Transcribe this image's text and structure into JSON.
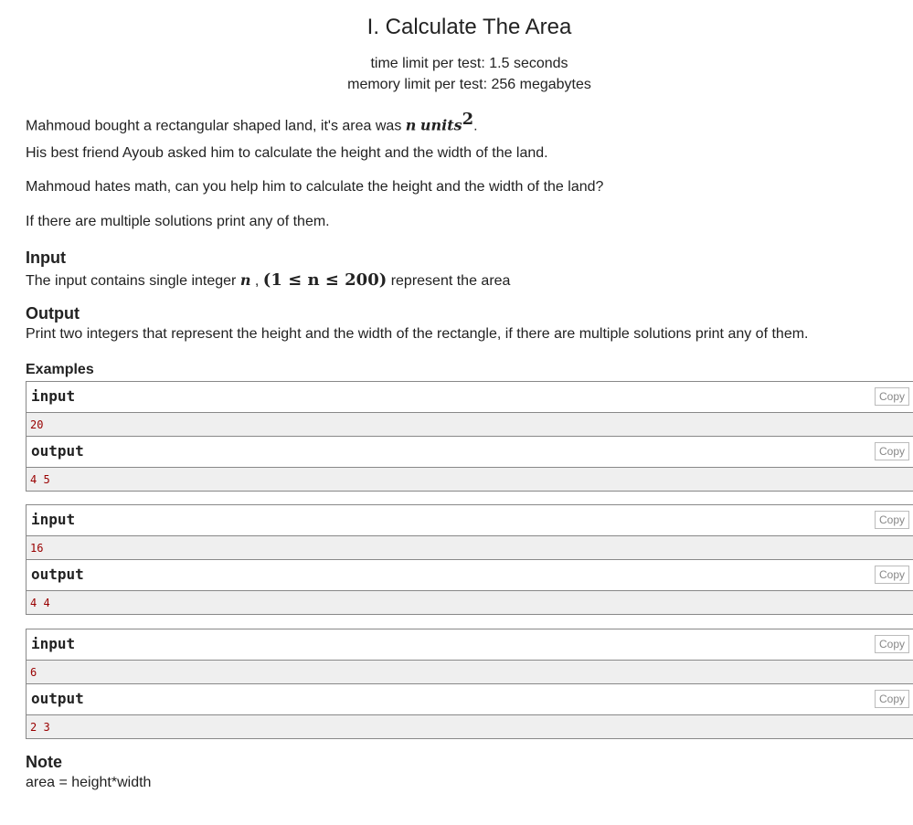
{
  "problem": {
    "title": "I. Calculate The Area",
    "time_limit": "time limit per test: 1.5 seconds",
    "memory_limit": "memory limit per test: 256 megabytes"
  },
  "statement": {
    "p1_text": "Mahmoud bought a rectangular shaped land, it's area was ",
    "p1_math_n": "n",
    "p1_math_units": "units",
    "p1_sup": "2",
    "p1_end": ".",
    "p2": "His best friend Ayoub asked him to calculate the height and the width of the land.",
    "p3": "Mahmoud hates math, can you help him to calculate the height and the width of the land?",
    "p4": "If there are multiple solutions print any of them."
  },
  "input_section": {
    "title": "Input",
    "text_before": "The input contains single integer ",
    "math_n": "n",
    "text_mid": " , ",
    "math_constraint": "(1 ≤ n ≤ 200)",
    "text_after": " represent the area"
  },
  "output_section": {
    "title": "Output",
    "text": "Print two integers that represent the height and the width of the rectangle, if there are multiple solutions print any of them."
  },
  "examples": {
    "title": "Examples",
    "input_label": "input",
    "output_label": "output",
    "copy_label": "Copy",
    "items": [
      {
        "input": "20",
        "output": "4 5"
      },
      {
        "input": "16",
        "output": "4 4"
      },
      {
        "input": "6",
        "output": "2 3"
      }
    ]
  },
  "note": {
    "title": "Note",
    "text": "area = height*width"
  }
}
